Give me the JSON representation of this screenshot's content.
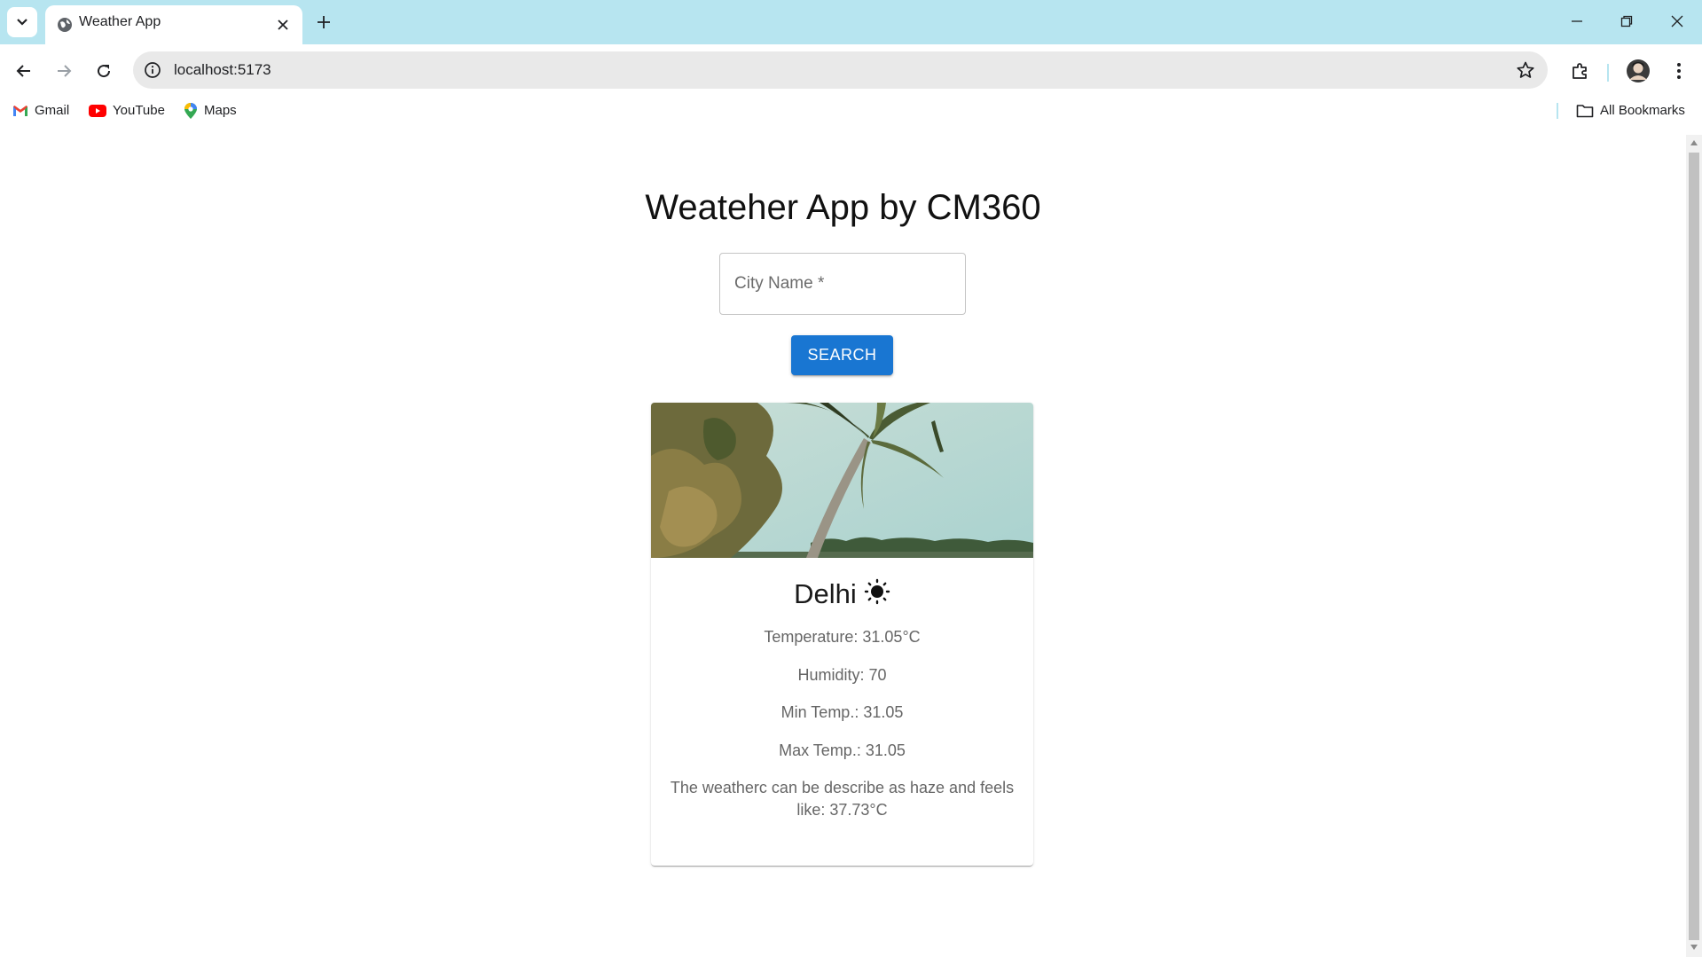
{
  "browser": {
    "tab_title": "Weather App",
    "url": "localhost:5173",
    "tabbar_color": "#b7e5f0",
    "bookmarks": [
      {
        "label": "Gmail",
        "icon": "gmail-icon"
      },
      {
        "label": "YouTube",
        "icon": "youtube-icon"
      },
      {
        "label": "Maps",
        "icon": "maps-icon"
      }
    ],
    "all_bookmarks_label": "All Bookmarks"
  },
  "page": {
    "title": "Weateher App by CM360",
    "search": {
      "label": "City Name *",
      "button_label": "SEARCH",
      "button_color": "#1976d2"
    },
    "card": {
      "city": "Delhi",
      "weather_icon": "sun-icon",
      "temperature": "Temperature: 31.05°C",
      "humidity": "Humidity: 70",
      "min_temp": "Min Temp.: 31.05",
      "max_temp": "Max Temp.: 31.05",
      "description": "The weatherc can be describe as haze and feels like: 37.73°C"
    }
  }
}
